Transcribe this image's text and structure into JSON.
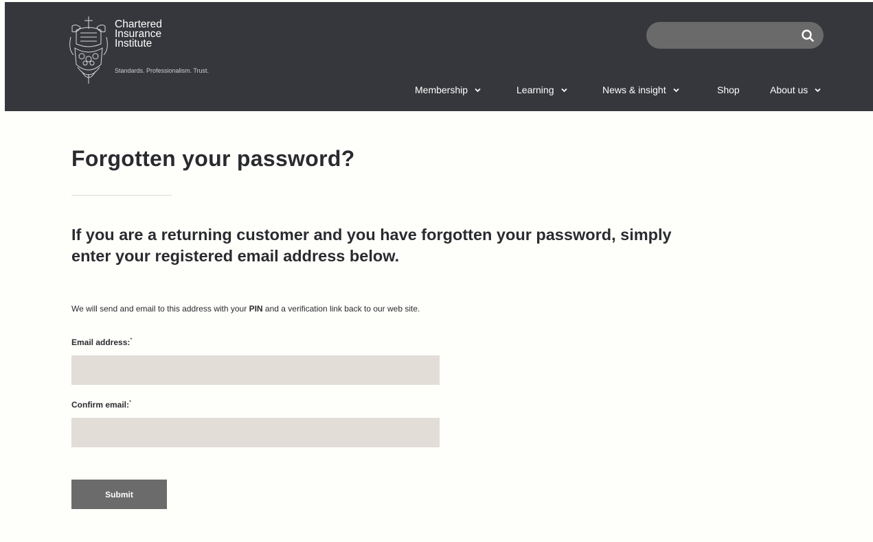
{
  "header": {
    "logo": {
      "line1": "Chartered",
      "line2": "Insurance",
      "line3": "Institute",
      "tagline": "Standards. Professionalism. Trust.",
      "icon": "crest-icon"
    },
    "search": {
      "placeholder": "",
      "icon": "search-icon"
    },
    "nav": [
      {
        "label": "Membership",
        "has_dropdown": true
      },
      {
        "label": "Learning",
        "has_dropdown": true
      },
      {
        "label": "News & insight",
        "has_dropdown": true
      },
      {
        "label": "Shop",
        "has_dropdown": false
      },
      {
        "label": "About us",
        "has_dropdown": true
      }
    ],
    "background": "#35373c"
  },
  "main": {
    "title": "Forgotten your password?",
    "subtitle": "If you are a returning customer and you have forgotten your password, simply enter your registered email address below.",
    "intro_before": "We will send and email to this address with your ",
    "intro_bold": "PIN",
    "intro_after": " and a verification link back to our web site.",
    "email_label": "Email address:",
    "confirm_label": "Confirm email:",
    "required_mark": "*",
    "email_value": "",
    "confirm_value": "",
    "submit_label": "Submit"
  },
  "colors": {
    "page_bg": "#fefefb",
    "input_bg": "#e2ddd7",
    "button_bg": "#6b6b6b",
    "text": "#2a2b2f"
  }
}
